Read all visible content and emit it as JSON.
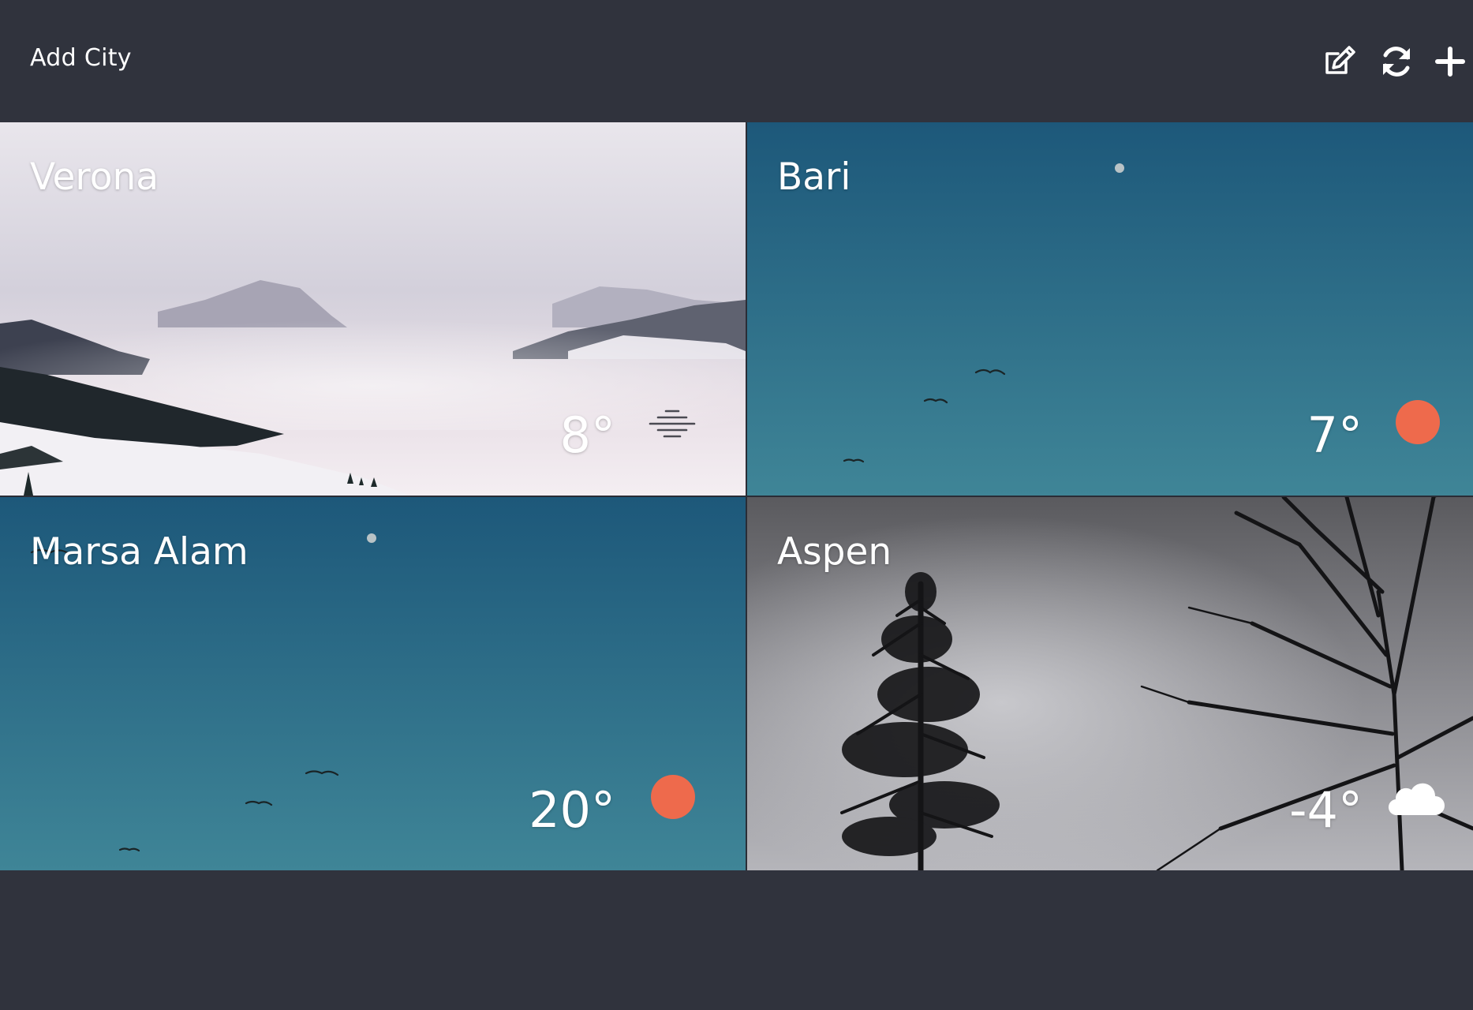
{
  "header": {
    "title": "Add City",
    "actions": [
      {
        "icon": "edit-icon"
      },
      {
        "icon": "refresh-icon"
      },
      {
        "icon": "plus-icon"
      }
    ]
  },
  "cities": [
    {
      "name": "Verona",
      "temperature": "8°",
      "condition_icon": "fog-icon"
    },
    {
      "name": "Bari",
      "temperature": "7°",
      "condition_icon": "sun-icon"
    },
    {
      "name": "Marsa Alam",
      "temperature": "20°",
      "condition_icon": "sun-icon"
    },
    {
      "name": "Aspen",
      "temperature": "-4°",
      "condition_icon": "cloud-icon"
    }
  ],
  "colors": {
    "background": "#30333d",
    "sun": "#ee6a4c",
    "sky_top": "#1d587a",
    "sky_bottom": "#3f8597"
  }
}
